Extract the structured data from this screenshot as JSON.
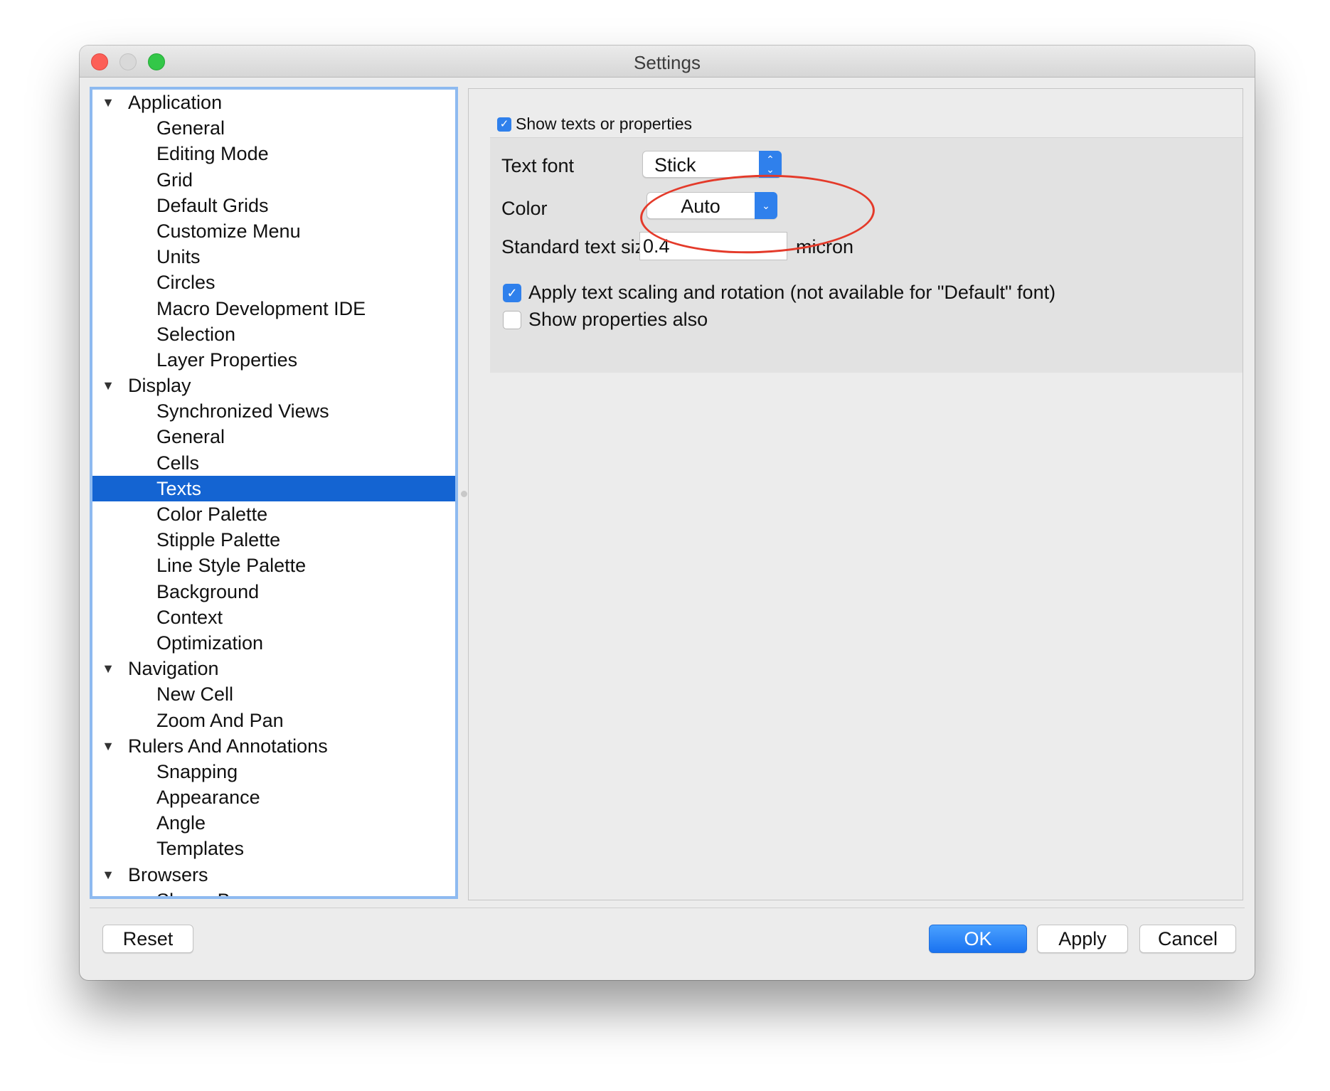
{
  "window": {
    "title": "Settings"
  },
  "tree": [
    {
      "label": "Application",
      "level": 0,
      "expanded": true
    },
    {
      "label": "General",
      "level": 1
    },
    {
      "label": "Editing Mode",
      "level": 1
    },
    {
      "label": "Grid",
      "level": 1
    },
    {
      "label": "Default Grids",
      "level": 1
    },
    {
      "label": "Customize Menu",
      "level": 1
    },
    {
      "label": "Units",
      "level": 1
    },
    {
      "label": "Circles",
      "level": 1
    },
    {
      "label": "Macro Development IDE",
      "level": 1
    },
    {
      "label": "Selection",
      "level": 1
    },
    {
      "label": "Layer Properties",
      "level": 1
    },
    {
      "label": "Display",
      "level": 0,
      "expanded": true
    },
    {
      "label": "Synchronized Views",
      "level": 1
    },
    {
      "label": "General",
      "level": 1
    },
    {
      "label": "Cells",
      "level": 1
    },
    {
      "label": "Texts",
      "level": 1,
      "selected": true
    },
    {
      "label": "Color Palette",
      "level": 1
    },
    {
      "label": "Stipple Palette",
      "level": 1
    },
    {
      "label": "Line Style Palette",
      "level": 1
    },
    {
      "label": "Background",
      "level": 1
    },
    {
      "label": "Context",
      "level": 1
    },
    {
      "label": "Optimization",
      "level": 1
    },
    {
      "label": "Navigation",
      "level": 0,
      "expanded": true
    },
    {
      "label": "New Cell",
      "level": 1
    },
    {
      "label": "Zoom And Pan",
      "level": 1
    },
    {
      "label": "Rulers And Annotations",
      "level": 0,
      "expanded": true
    },
    {
      "label": "Snapping",
      "level": 1
    },
    {
      "label": "Appearance",
      "level": 1
    },
    {
      "label": "Angle",
      "level": 1
    },
    {
      "label": "Templates",
      "level": 1
    },
    {
      "label": "Browsers",
      "level": 0,
      "expanded": true
    },
    {
      "label": "Shape Browser",
      "level": 1
    }
  ],
  "panel": {
    "show_texts_label": "Show texts or properties",
    "show_texts_checked": true,
    "text_font_label": "Text font",
    "text_font_value": "Stick",
    "color_label": "Color",
    "color_value": "Auto",
    "text_size_label": "Standard text size",
    "text_size_value": "0.4",
    "text_size_unit": "micron",
    "apply_scaling_label": "Apply text scaling and rotation (not available for \"Default\" font)",
    "apply_scaling_checked": true,
    "show_properties_label": "Show properties also",
    "show_properties_checked": false
  },
  "footer": {
    "reset": "Reset",
    "ok": "OK",
    "apply": "Apply",
    "cancel": "Cancel"
  },
  "colors": {
    "accent": "#2f80ec",
    "selection": "#1464d2",
    "annotation": "#e43a2a"
  },
  "icons": {
    "expanded": "disclosure-triangle-down",
    "combo": "updown-chevron",
    "dropdown": "chevron-down"
  }
}
